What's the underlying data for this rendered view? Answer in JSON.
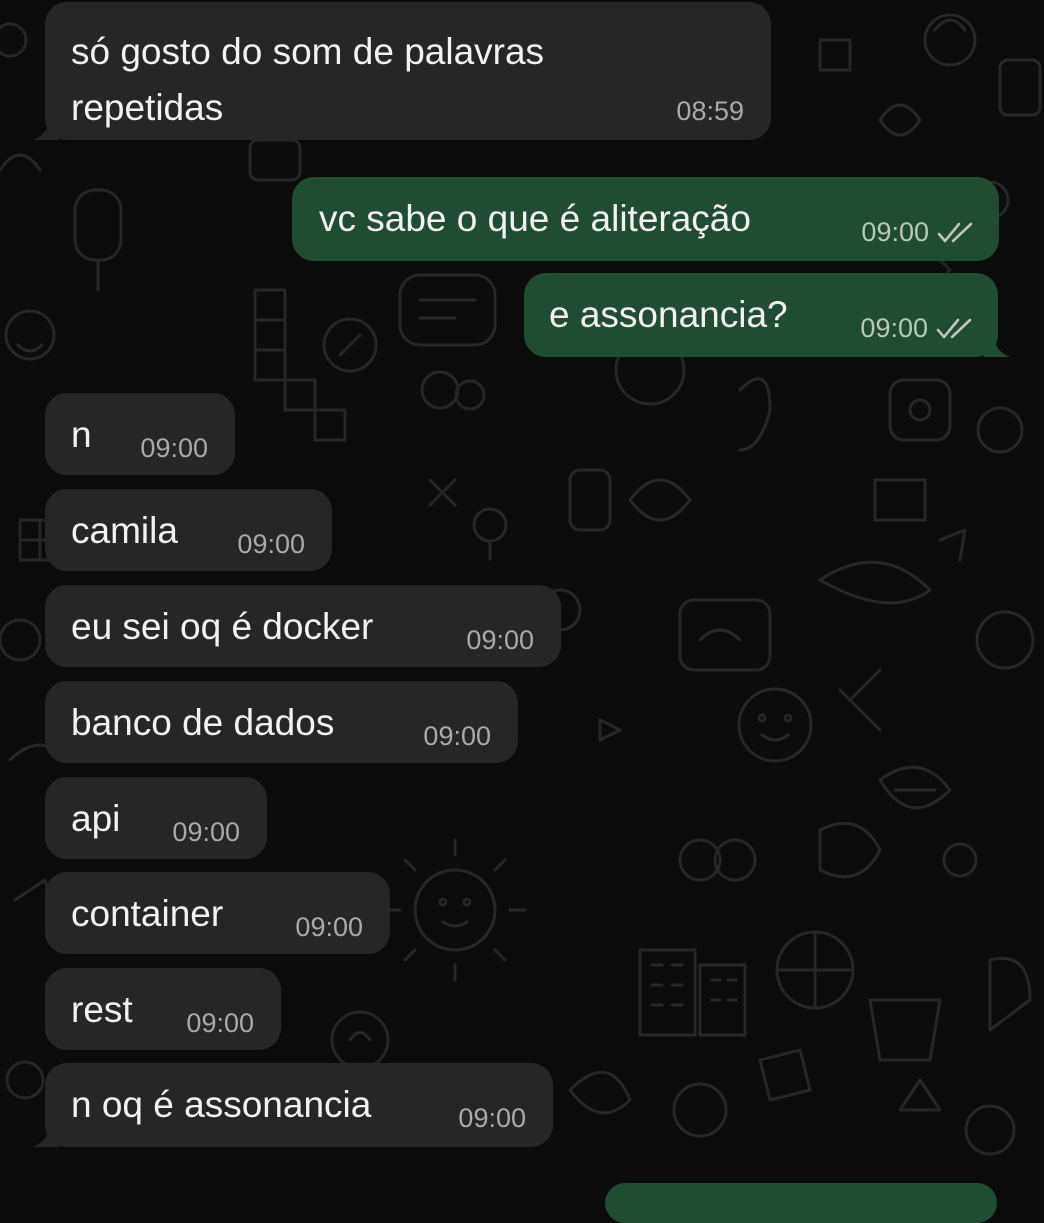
{
  "conversation": {
    "messages": [
      {
        "direction": "in",
        "lines": [
          "só gosto do som de palavras",
          "repetidas"
        ],
        "time": "08:59"
      },
      {
        "direction": "out",
        "lines": [
          "vc sabe o que é aliteração"
        ],
        "time": "09:00",
        "status": "read-double-check-icon"
      },
      {
        "direction": "out",
        "lines": [
          "e assonancia?"
        ],
        "time": "09:00",
        "status": "read-double-check-icon"
      },
      {
        "direction": "in",
        "lines": [
          "n"
        ],
        "time": "09:00"
      },
      {
        "direction": "in",
        "lines": [
          "camila"
        ],
        "time": "09:00"
      },
      {
        "direction": "in",
        "lines": [
          "eu sei oq é docker"
        ],
        "time": "09:00"
      },
      {
        "direction": "in",
        "lines": [
          "banco de dados"
        ],
        "time": "09:00"
      },
      {
        "direction": "in",
        "lines": [
          "api"
        ],
        "time": "09:00"
      },
      {
        "direction": "in",
        "lines": [
          "container"
        ],
        "time": "09:00"
      },
      {
        "direction": "in",
        "lines": [
          "rest"
        ],
        "time": "09:00"
      },
      {
        "direction": "in",
        "lines": [
          "n oq é assonancia"
        ],
        "time": "09:00"
      }
    ]
  },
  "colors": {
    "background": "#0b0b0b",
    "incoming_bubble": "#262626",
    "outgoing_bubble": "#1e4d31",
    "timestamp": "#a9a9a9"
  }
}
